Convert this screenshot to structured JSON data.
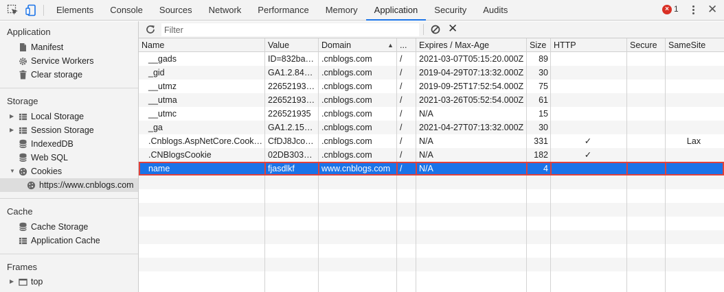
{
  "tabs": [
    "Elements",
    "Console",
    "Sources",
    "Network",
    "Performance",
    "Memory",
    "Application",
    "Security",
    "Audits"
  ],
  "active_tab": "Application",
  "error_count": "1",
  "sidebar": {
    "application": {
      "title": "Application",
      "items": [
        {
          "label": "Manifest",
          "icon": "document-icon"
        },
        {
          "label": "Service Workers",
          "icon": "gear-icon"
        },
        {
          "label": "Clear storage",
          "icon": "trash-icon"
        }
      ]
    },
    "storage": {
      "title": "Storage",
      "items": [
        {
          "label": "Local Storage",
          "icon": "grid-icon"
        },
        {
          "label": "Session Storage",
          "icon": "grid-icon"
        },
        {
          "label": "IndexedDB",
          "icon": "database-icon"
        },
        {
          "label": "Web SQL",
          "icon": "database-icon"
        },
        {
          "label": "Cookies",
          "icon": "cookie-icon"
        },
        {
          "label": "https://www.cnblogs.com",
          "icon": "cookie-icon"
        }
      ]
    },
    "cache": {
      "title": "Cache",
      "items": [
        {
          "label": "Cache Storage",
          "icon": "database-icon"
        },
        {
          "label": "Application Cache",
          "icon": "grid-icon"
        }
      ]
    },
    "frames": {
      "title": "Frames",
      "items": [
        {
          "label": "top",
          "icon": "frame-icon"
        }
      ]
    }
  },
  "toolbar": {
    "filter_placeholder": "Filter"
  },
  "table": {
    "columns": [
      "Name",
      "Value",
      "Domain",
      "...",
      "Expires / Max-Age",
      "Size",
      "HTTP",
      "Secure",
      "SameSite"
    ],
    "sorted_column": "Domain",
    "rows": [
      [
        "__gads",
        "ID=832ba…",
        ".cnblogs.com",
        "/",
        "2021-03-07T05:15:20.000Z",
        "89",
        "",
        "",
        ""
      ],
      [
        "_gid",
        "GA1.2.846…",
        ".cnblogs.com",
        "/",
        "2019-04-29T07:13:32.000Z",
        "30",
        "",
        "",
        ""
      ],
      [
        "__utmz",
        "22652193…",
        ".cnblogs.com",
        "/",
        "2019-09-25T17:52:54.000Z",
        "75",
        "",
        "",
        ""
      ],
      [
        "__utma",
        "22652193…",
        ".cnblogs.com",
        "/",
        "2021-03-26T05:52:54.000Z",
        "61",
        "",
        "",
        ""
      ],
      [
        "__utmc",
        "226521935",
        ".cnblogs.com",
        "/",
        "N/A",
        "15",
        "",
        "",
        ""
      ],
      [
        "_ga",
        "GA1.2.158…",
        ".cnblogs.com",
        "/",
        "2021-04-27T07:13:32.000Z",
        "30",
        "",
        "",
        ""
      ],
      [
        ".Cnblogs.AspNetCore.Cookies",
        "CfDJ8Jco…",
        ".cnblogs.com",
        "/",
        "N/A",
        "331",
        "✓",
        "",
        "Lax"
      ],
      [
        ".CNBlogsCookie",
        "02DB303…",
        ".cnblogs.com",
        "/",
        "N/A",
        "182",
        "✓",
        "",
        ""
      ],
      [
        "name",
        "fjasdlkf",
        "www.cnblogs.com",
        "/",
        "N/A",
        "4",
        "",
        "",
        ""
      ]
    ],
    "selected_row": 8
  },
  "colors": {
    "accent": "#1a73e8",
    "selection_outline": "#e0403a",
    "error": "#d93025"
  }
}
